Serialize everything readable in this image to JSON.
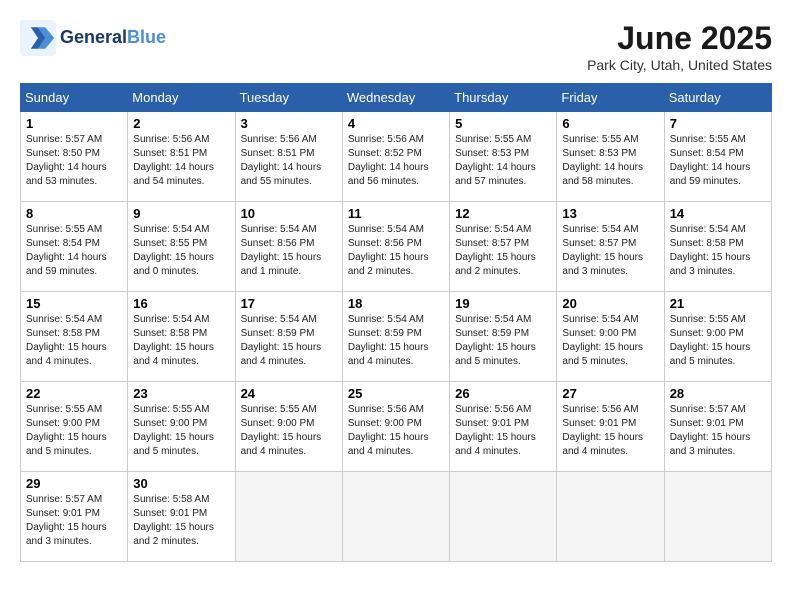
{
  "logo": {
    "line1": "General",
    "line2": "Blue"
  },
  "title": "June 2025",
  "location": "Park City, Utah, United States",
  "weekdays": [
    "Sunday",
    "Monday",
    "Tuesday",
    "Wednesday",
    "Thursday",
    "Friday",
    "Saturday"
  ],
  "weeks": [
    [
      {
        "day": 1,
        "info": "Sunrise: 5:57 AM\nSunset: 8:50 PM\nDaylight: 14 hours\nand 53 minutes."
      },
      {
        "day": 2,
        "info": "Sunrise: 5:56 AM\nSunset: 8:51 PM\nDaylight: 14 hours\nand 54 minutes."
      },
      {
        "day": 3,
        "info": "Sunrise: 5:56 AM\nSunset: 8:51 PM\nDaylight: 14 hours\nand 55 minutes."
      },
      {
        "day": 4,
        "info": "Sunrise: 5:56 AM\nSunset: 8:52 PM\nDaylight: 14 hours\nand 56 minutes."
      },
      {
        "day": 5,
        "info": "Sunrise: 5:55 AM\nSunset: 8:53 PM\nDaylight: 14 hours\nand 57 minutes."
      },
      {
        "day": 6,
        "info": "Sunrise: 5:55 AM\nSunset: 8:53 PM\nDaylight: 14 hours\nand 58 minutes."
      },
      {
        "day": 7,
        "info": "Sunrise: 5:55 AM\nSunset: 8:54 PM\nDaylight: 14 hours\nand 59 minutes."
      }
    ],
    [
      {
        "day": 8,
        "info": "Sunrise: 5:55 AM\nSunset: 8:54 PM\nDaylight: 14 hours\nand 59 minutes."
      },
      {
        "day": 9,
        "info": "Sunrise: 5:54 AM\nSunset: 8:55 PM\nDaylight: 15 hours\nand 0 minutes."
      },
      {
        "day": 10,
        "info": "Sunrise: 5:54 AM\nSunset: 8:56 PM\nDaylight: 15 hours\nand 1 minute."
      },
      {
        "day": 11,
        "info": "Sunrise: 5:54 AM\nSunset: 8:56 PM\nDaylight: 15 hours\nand 2 minutes."
      },
      {
        "day": 12,
        "info": "Sunrise: 5:54 AM\nSunset: 8:57 PM\nDaylight: 15 hours\nand 2 minutes."
      },
      {
        "day": 13,
        "info": "Sunrise: 5:54 AM\nSunset: 8:57 PM\nDaylight: 15 hours\nand 3 minutes."
      },
      {
        "day": 14,
        "info": "Sunrise: 5:54 AM\nSunset: 8:58 PM\nDaylight: 15 hours\nand 3 minutes."
      }
    ],
    [
      {
        "day": 15,
        "info": "Sunrise: 5:54 AM\nSunset: 8:58 PM\nDaylight: 15 hours\nand 4 minutes."
      },
      {
        "day": 16,
        "info": "Sunrise: 5:54 AM\nSunset: 8:58 PM\nDaylight: 15 hours\nand 4 minutes."
      },
      {
        "day": 17,
        "info": "Sunrise: 5:54 AM\nSunset: 8:59 PM\nDaylight: 15 hours\nand 4 minutes."
      },
      {
        "day": 18,
        "info": "Sunrise: 5:54 AM\nSunset: 8:59 PM\nDaylight: 15 hours\nand 4 minutes."
      },
      {
        "day": 19,
        "info": "Sunrise: 5:54 AM\nSunset: 8:59 PM\nDaylight: 15 hours\nand 5 minutes."
      },
      {
        "day": 20,
        "info": "Sunrise: 5:54 AM\nSunset: 9:00 PM\nDaylight: 15 hours\nand 5 minutes."
      },
      {
        "day": 21,
        "info": "Sunrise: 5:55 AM\nSunset: 9:00 PM\nDaylight: 15 hours\nand 5 minutes."
      }
    ],
    [
      {
        "day": 22,
        "info": "Sunrise: 5:55 AM\nSunset: 9:00 PM\nDaylight: 15 hours\nand 5 minutes."
      },
      {
        "day": 23,
        "info": "Sunrise: 5:55 AM\nSunset: 9:00 PM\nDaylight: 15 hours\nand 5 minutes."
      },
      {
        "day": 24,
        "info": "Sunrise: 5:55 AM\nSunset: 9:00 PM\nDaylight: 15 hours\nand 4 minutes."
      },
      {
        "day": 25,
        "info": "Sunrise: 5:56 AM\nSunset: 9:00 PM\nDaylight: 15 hours\nand 4 minutes."
      },
      {
        "day": 26,
        "info": "Sunrise: 5:56 AM\nSunset: 9:01 PM\nDaylight: 15 hours\nand 4 minutes."
      },
      {
        "day": 27,
        "info": "Sunrise: 5:56 AM\nSunset: 9:01 PM\nDaylight: 15 hours\nand 4 minutes."
      },
      {
        "day": 28,
        "info": "Sunrise: 5:57 AM\nSunset: 9:01 PM\nDaylight: 15 hours\nand 3 minutes."
      }
    ],
    [
      {
        "day": 29,
        "info": "Sunrise: 5:57 AM\nSunset: 9:01 PM\nDaylight: 15 hours\nand 3 minutes."
      },
      {
        "day": 30,
        "info": "Sunrise: 5:58 AM\nSunset: 9:01 PM\nDaylight: 15 hours\nand 2 minutes."
      },
      {
        "day": null,
        "info": ""
      },
      {
        "day": null,
        "info": ""
      },
      {
        "day": null,
        "info": ""
      },
      {
        "day": null,
        "info": ""
      },
      {
        "day": null,
        "info": ""
      }
    ]
  ]
}
